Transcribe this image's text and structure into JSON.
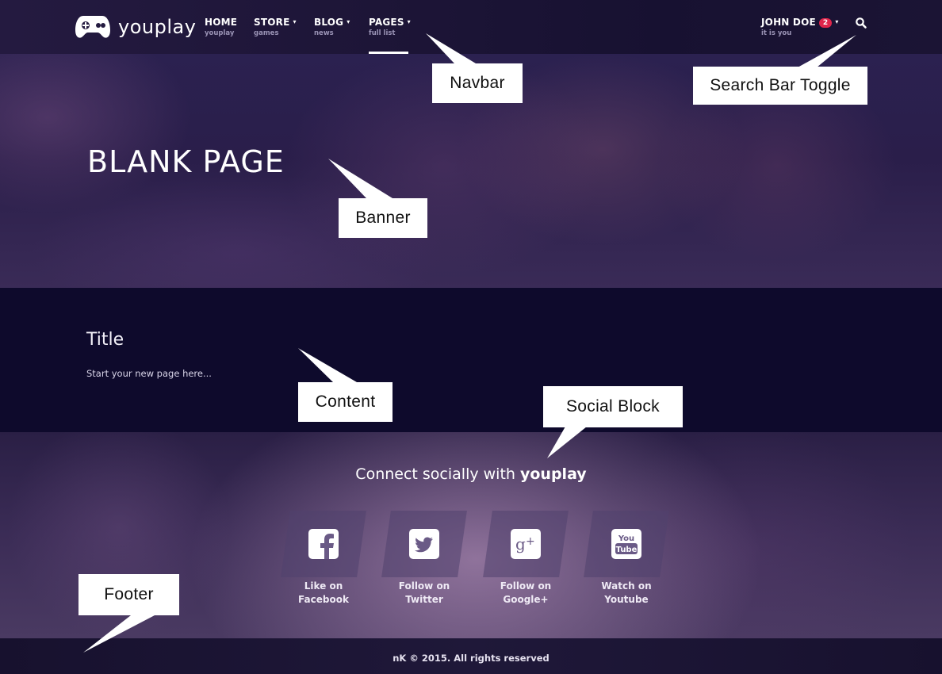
{
  "brand": {
    "name": "youplay"
  },
  "nav": {
    "items": [
      {
        "label": "HOME",
        "sub": "youplay",
        "has_caret": false
      },
      {
        "label": "STORE",
        "sub": "games",
        "has_caret": true
      },
      {
        "label": "BLOG",
        "sub": "news",
        "has_caret": true
      },
      {
        "label": "PAGES",
        "sub": "full list",
        "has_caret": true,
        "active": true
      }
    ],
    "user": {
      "name": "JOHN DOE",
      "sub": "it is you",
      "notifications": "2"
    },
    "caret": "▾",
    "search_icon": "search-icon"
  },
  "banner": {
    "title": "BLANK PAGE"
  },
  "content": {
    "title": "Title",
    "text": "Start your new page here..."
  },
  "social": {
    "heading_prefix": "Connect socially with ",
    "heading_brand": "youplay",
    "items": [
      {
        "icon": "facebook-icon",
        "line1": "Like on",
        "line2": "Facebook"
      },
      {
        "icon": "twitter-icon",
        "line1": "Follow on",
        "line2": "Twitter"
      },
      {
        "icon": "google-plus-icon",
        "line1": "Follow on",
        "line2": "Google+"
      },
      {
        "icon": "youtube-icon",
        "line1": "Watch on",
        "line2": "Youtube"
      }
    ]
  },
  "footer": {
    "brand": "nK",
    "copyright": " © 2015. All rights reserved"
  },
  "annotations": {
    "navbar": "Navbar",
    "search": "Search Bar Toggle",
    "banner": "Banner",
    "content": "Content",
    "social": "Social Block",
    "footer": "Footer"
  },
  "colors": {
    "badge": "#e0254b",
    "content_bg": "#0e0a2c",
    "footer_bg": "#1f1839"
  }
}
